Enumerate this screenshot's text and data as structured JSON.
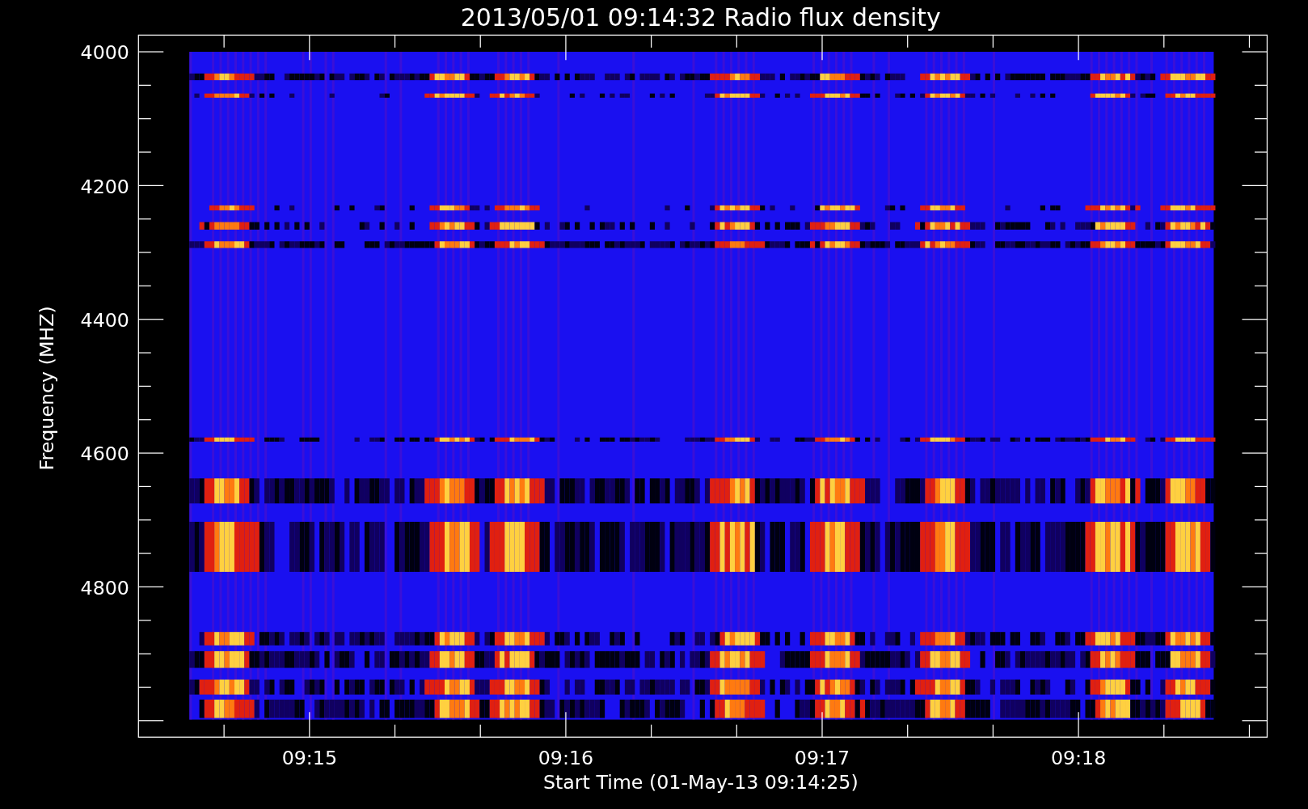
{
  "title": "2013/05/01 09:14:32 Radio flux density",
  "y_axis": {
    "label": "Frequency (MHZ)",
    "tick_labels": [
      "4000",
      "4200",
      "4400",
      "4600",
      "4800"
    ]
  },
  "x_axis": {
    "label": "Start Time (01-May-13 09:14:25)",
    "tick_labels": [
      "09:15",
      "09:16",
      "09:17",
      "09:18"
    ]
  }
}
